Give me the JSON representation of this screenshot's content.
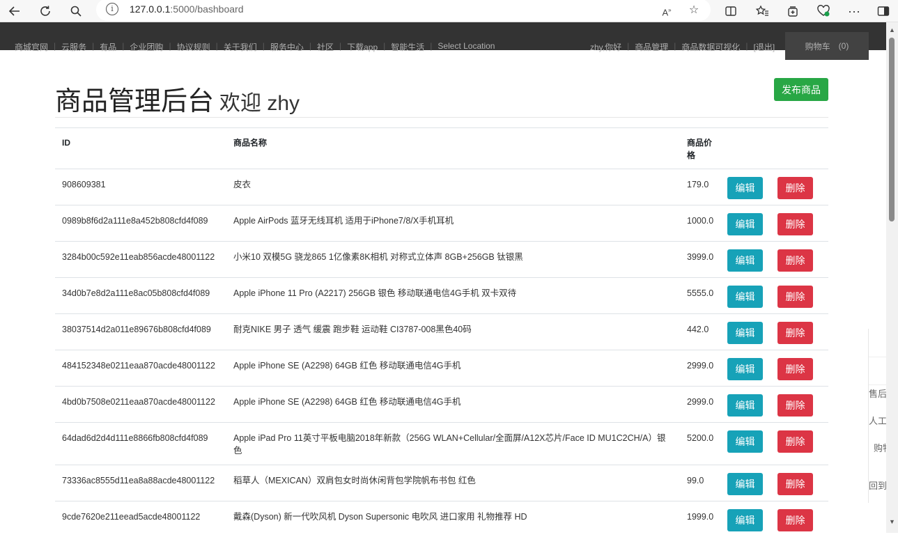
{
  "browser": {
    "url_host": "127.0.0.1",
    "url_path": ":5000/bashboard"
  },
  "site_nav": {
    "links": [
      "商城官网",
      "云服务",
      "有品",
      "企业团购",
      "协议规则",
      "关于我们",
      "服务中心",
      "社区",
      "下载app",
      "智能生活",
      "Select Location"
    ],
    "user_links": [
      "zhy,你好",
      "商品管理",
      "商品数据可视化",
      "[退出]"
    ],
    "cart_label": "购物车",
    "cart_count": "(0)"
  },
  "header": {
    "title": "商品管理后台",
    "welcome": "欢迎 zhy",
    "publish_label": "发布商品"
  },
  "table": {
    "columns": [
      "ID",
      "商品名称",
      "商品价格"
    ],
    "edit_label": "编辑",
    "delete_label": "删除",
    "rows": [
      {
        "id": "908609381",
        "name": "皮衣",
        "price": "179.0"
      },
      {
        "id": "0989b8f6d2a111e8a452b808cfd4f089",
        "name": "Apple AirPods 蓝牙无线耳机 适用于iPhone7/8/X手机耳机",
        "price": "1000.0"
      },
      {
        "id": "3284b00c592e11eab856acde48001122",
        "name": "小米10 双模5G 骁龙865 1亿像素8K相机 对称式立体声 8GB+256GB 钛银黑",
        "price": "3999.0"
      },
      {
        "id": "34d0b7e8d2a111e8ac05b808cfd4f089",
        "name": "Apple iPhone 11 Pro (A2217) 256GB 银色 移动联通电信4G手机 双卡双待",
        "price": "5555.0"
      },
      {
        "id": "38037514d2a011e89676b808cfd4f089",
        "name": "耐克NIKE 男子 透气 缓震 跑步鞋 运动鞋 CI3787-008黑色40码",
        "price": "442.0"
      },
      {
        "id": "484152348e0211eaa870acde48001122",
        "name": "Apple iPhone SE (A2298) 64GB 红色 移动联通电信4G手机",
        "price": "2999.0"
      },
      {
        "id": "4bd0b7508e0211eaa870acde48001122",
        "name": "Apple iPhone SE (A2298) 64GB 红色 移动联通电信4G手机",
        "price": "2999.0"
      },
      {
        "id": "64dad6d2d4d111e8866fb808cfd4f089",
        "name": "Apple iPad Pro 11英寸平板电脑2018年新款（256G WLAN+Cellular/全面屏/A12X芯片/Face ID MU1C2CH/A）银色",
        "price": "5200.0"
      },
      {
        "id": "73336ac8555d11ea8a88acde48001122",
        "name": "稻草人（MEXICAN）双肩包女时尚休闲背包学院帆布书包 红色",
        "price": "99.0"
      },
      {
        "id": "9cde7620e211eead5acde48001122",
        "name": "戴森(Dyson) 新一代吹风机 Dyson Supersonic 电吹风 进口家用 礼物推荐 HD",
        "price": "1999.0"
      }
    ]
  },
  "side_widget": {
    "items": [
      "售后",
      "人工",
      "购物",
      "回到"
    ]
  }
}
